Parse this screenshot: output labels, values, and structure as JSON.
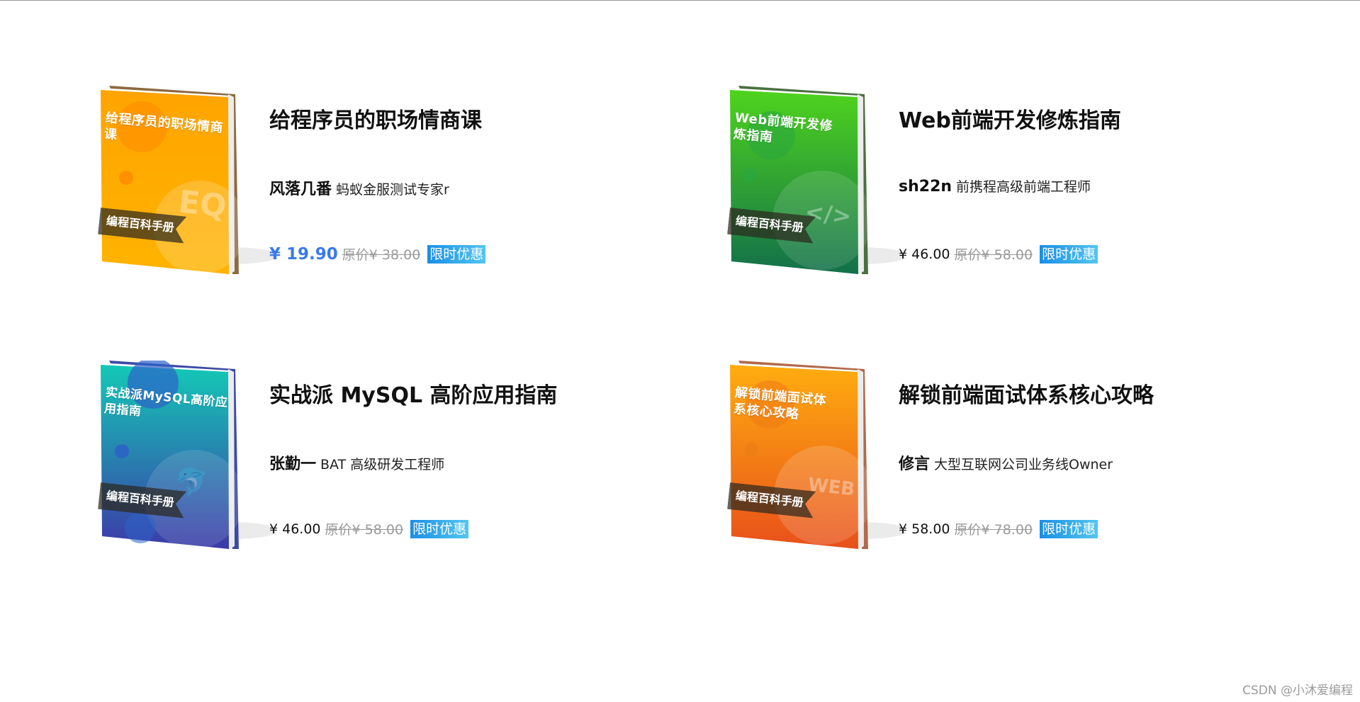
{
  "books": [
    {
      "title": "给程序员的职场情商课",
      "cover_title": "给程序员的职场情商课",
      "ribbon": "编程百科手册",
      "deco": "EQ",
      "author": "风落几番",
      "author_desc": "蚂蚁金服测试专家r",
      "price": "¥ 19.90",
      "old_price": "原价¥ 38.00",
      "badge": "限时优惠",
      "price_highlight": true,
      "colors": {
        "top": "#ffa400",
        "bottom": "#ffb300",
        "spine": "#8c6a3f",
        "circle": "#ff8a00"
      }
    },
    {
      "title": "Web前端开发修炼指南",
      "cover_title": "Web前端开发修炼指南",
      "ribbon": "编程百科手册",
      "deco": "</>",
      "author": "sh22n",
      "author_desc": "前携程高级前端工程师",
      "price": "¥ 46.00",
      "old_price": "原价¥ 58.00",
      "badge": "限时优惠",
      "price_highlight": false,
      "colors": {
        "top": "#4fd41d",
        "bottom": "#12704a",
        "spine": "#4a7040",
        "circle": "#2aa83d"
      }
    },
    {
      "title": "实战派 MySQL 高阶应用指南",
      "cover_title": "实战派MySQL高阶应用指南",
      "ribbon": "编程百科手册",
      "deco": "🐬",
      "author": "张勤一",
      "author_desc": "BAT 高级研发工程师",
      "price": "¥ 46.00",
      "old_price": "原价¥ 58.00",
      "badge": "限时优惠",
      "price_highlight": false,
      "colors": {
        "top": "#13c9b6",
        "bottom": "#3c3aa8",
        "spine": "#3b4aa8",
        "circle": "#2d63c8"
      }
    },
    {
      "title": "解锁前端面试体系核心攻略",
      "cover_title": "解锁前端面试体系核心攻略",
      "ribbon": "编程百科手册",
      "deco": "WEB",
      "author": "修言",
      "author_desc": "大型互联网公司业务线Owner",
      "price": "¥ 58.00",
      "old_price": "原价¥ 78.00",
      "badge": "限时优惠",
      "price_highlight": false,
      "colors": {
        "top": "#ffad10",
        "bottom": "#e8501a",
        "spine": "#b16a4b",
        "circle": "#f07d16"
      }
    }
  ],
  "watermark": "CSDN @小沐爱编程"
}
